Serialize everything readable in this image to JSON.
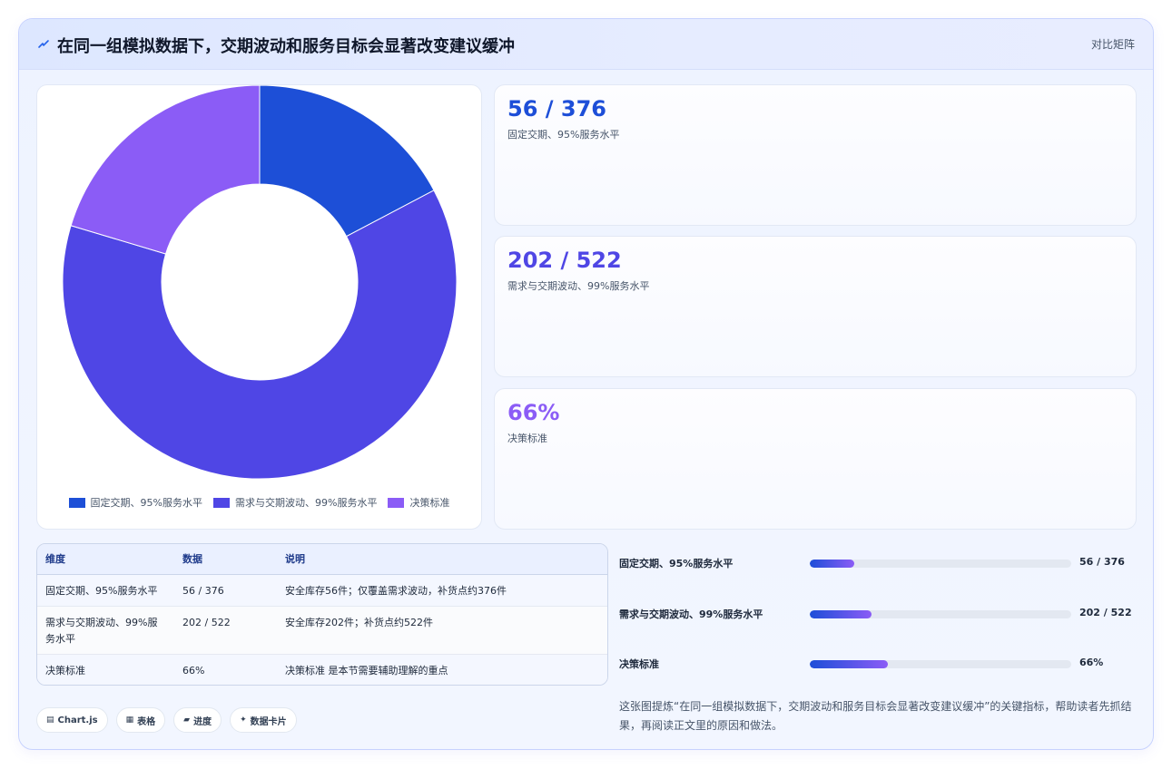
{
  "header": {
    "title": "在同一组模拟数据下，交期波动和服务目标会显著改变建议缓冲",
    "action": "对比矩阵",
    "logo_icon": "lightning-icon",
    "logo_color": "#2563eb"
  },
  "chart_data": {
    "type": "pie",
    "donut": true,
    "categories": [
      "固定交期、95%服务水平",
      "需求与交期波动、99%服务水平",
      "决策标准"
    ],
    "values": [
      56,
      202,
      66
    ],
    "colors": [
      "#1d4fd7",
      "#4f46e5",
      "#8b5cf6"
    ],
    "legend_position": "bottom"
  },
  "stats": [
    {
      "value": "56 / 376",
      "label": "固定交期、95%服务水平",
      "color": "#1d4ed8"
    },
    {
      "value": "202 / 522",
      "label": "需求与交期波动、99%服务水平",
      "color": "#4f46e5"
    },
    {
      "value": "66%",
      "label": "决策标准",
      "color": "#8b5cf6"
    }
  ],
  "table": {
    "headers": [
      "维度",
      "数据",
      "说明"
    ],
    "rows": [
      [
        "固定交期、95%服务水平",
        "56 / 376",
        "安全库存56件；仅覆盖需求波动，补货点约376件"
      ],
      [
        "需求与交期波动、99%服务水平",
        "202 / 522",
        "安全库存202件；补货点约522件"
      ],
      [
        "决策标准",
        "66%",
        "决策标准 是本节需要辅助理解的重点"
      ]
    ]
  },
  "chips": [
    {
      "icon": "▤",
      "label": "Chart.js"
    },
    {
      "icon": "▦",
      "label": "表格"
    },
    {
      "icon": "▰",
      "label": "进度"
    },
    {
      "icon": "✦",
      "label": "数据卡片"
    }
  ],
  "progress": [
    {
      "label": "固定交期、95%服务水平",
      "value": "56 / 376",
      "fraction": 0.17
    },
    {
      "label": "需求与交期波动、99%服务水平",
      "value": "202 / 522",
      "fraction": 0.235
    },
    {
      "label": "决策标准",
      "value": "66%",
      "fraction": 0.3
    }
  ],
  "note": "这张图提炼“在同一组模拟数据下，交期波动和服务目标会显著改变建议缓冲”的关键指标，帮助读者先抓结果，再阅读正文里的原因和做法。"
}
